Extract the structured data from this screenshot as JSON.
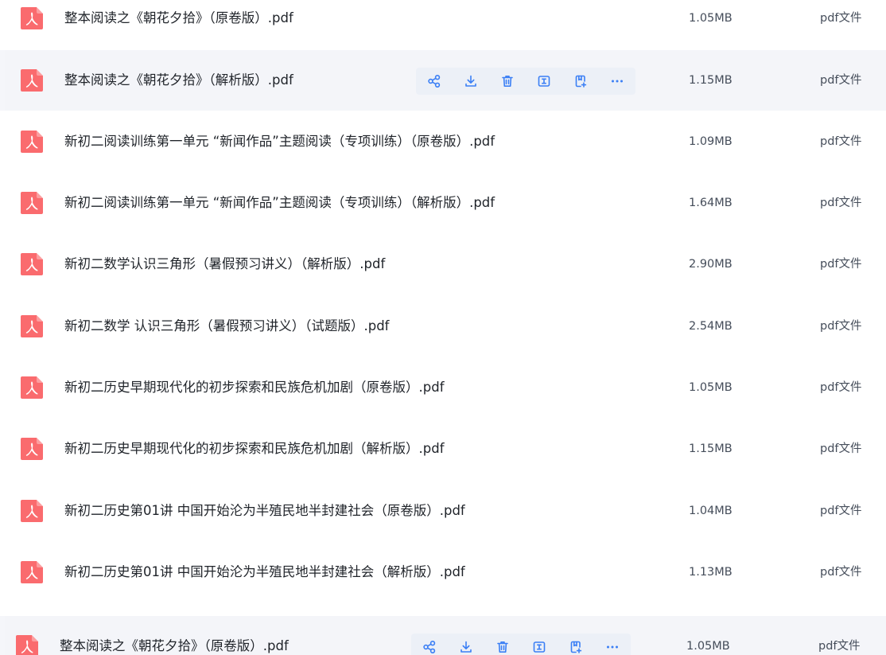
{
  "colors": {
    "pdf_icon": "#fa6b6e",
    "action_icon": "#3b7ff5",
    "hover_bg": "#f4f5f9"
  },
  "actions": [
    {
      "name": "share-button",
      "icon": "share-icon"
    },
    {
      "name": "download-button",
      "icon": "download-icon"
    },
    {
      "name": "delete-button",
      "icon": "trash-icon"
    },
    {
      "name": "rename-button",
      "icon": "rename-icon"
    },
    {
      "name": "copy-button",
      "icon": "copy-icon"
    },
    {
      "name": "more-button",
      "icon": "more-icon"
    }
  ],
  "files": [
    {
      "name": "整本阅读之《朝花夕拾》（原卷版）.pdf",
      "size": "1.05MB",
      "type": "pdf文件",
      "hovered": false
    },
    {
      "name": "整本阅读之《朝花夕拾》（解析版）.pdf",
      "size": "1.15MB",
      "type": "pdf文件",
      "hovered": true
    },
    {
      "name": "新初二阅读训练第一单元 “新闻作品”主题阅读（专项训练）（原卷版）.pdf",
      "size": "1.09MB",
      "type": "pdf文件",
      "hovered": false
    },
    {
      "name": "新初二阅读训练第一单元 “新闻作品”主题阅读（专项训练）（解析版）.pdf",
      "size": "1.64MB",
      "type": "pdf文件",
      "hovered": false
    },
    {
      "name": "新初二数学认识三角形（暑假预习讲义）（解析版）.pdf",
      "size": "2.90MB",
      "type": "pdf文件",
      "hovered": false
    },
    {
      "name": "新初二数学 认识三角形（暑假预习讲义）（试题版）.pdf",
      "size": "2.54MB",
      "type": "pdf文件",
      "hovered": false
    },
    {
      "name": "新初二历史早期现代化的初步探索和民族危机加剧（原卷版）.pdf",
      "size": "1.05MB",
      "type": "pdf文件",
      "hovered": false
    },
    {
      "name": "新初二历史早期现代化的初步探索和民族危机加剧（解析版）.pdf",
      "size": "1.15MB",
      "type": "pdf文件",
      "hovered": false
    },
    {
      "name": "新初二历史第01讲 中国开始沦为半殖民地半封建社会（原卷版）.pdf",
      "size": "1.04MB",
      "type": "pdf文件",
      "hovered": false
    },
    {
      "name": "新初二历史第01讲 中国开始沦为半殖民地半封建社会（解析版）.pdf",
      "size": "1.13MB",
      "type": "pdf文件",
      "hovered": false
    },
    {
      "name": "整本阅读之《朝花夕拾》（原卷版）.pdf",
      "size": "1.05MB",
      "type": "pdf文件",
      "hovered": true
    }
  ]
}
